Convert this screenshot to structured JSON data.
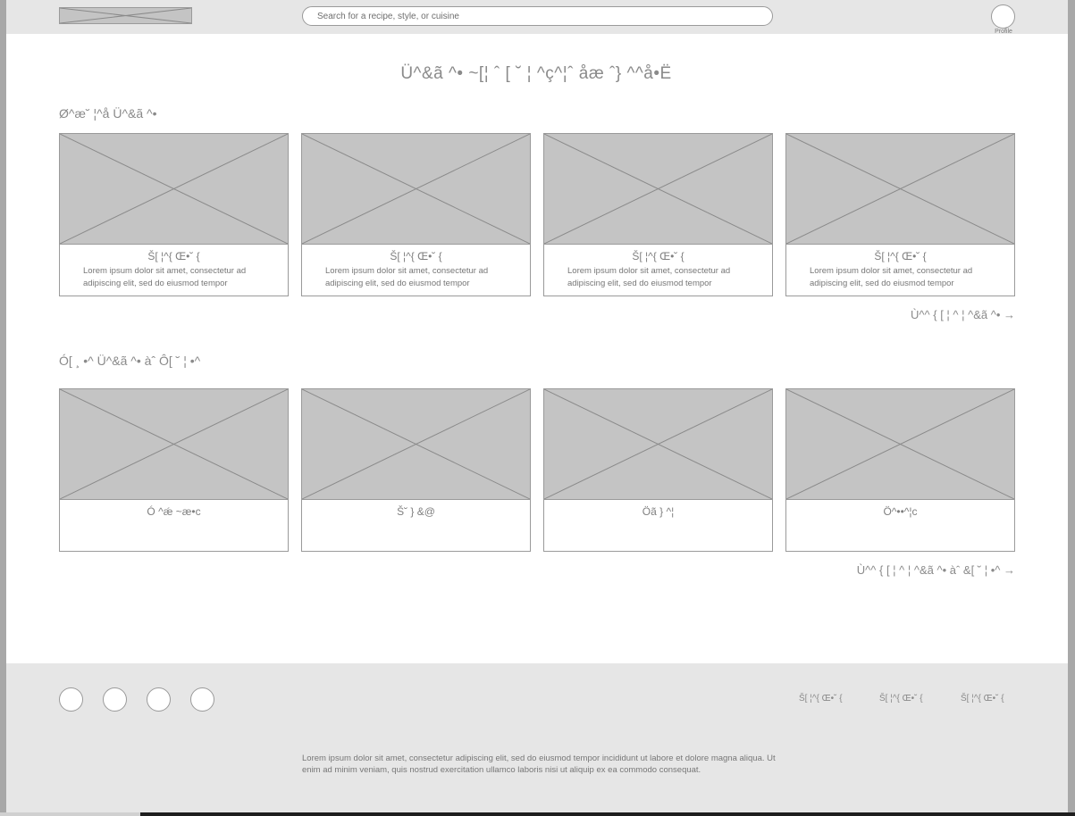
{
  "header": {
    "search_placeholder": "Search for a recipe, style, or cuisine",
    "profile_label": "Profile"
  },
  "page_title": "Ü^&ã ^• ~[¦ ˆ [ ˘ ¦ ^ç^¦ˆ åæ ˆ} ^^å•Ë",
  "popular": {
    "title": "Ø^æ˘ ¦^å Ü^&ã ^•",
    "cards": [
      {
        "title": "Š[ ¦^{   Œ•˘ {",
        "desc": "Lorem ipsum dolor sit amet, consectetur ad adipiscing elit, sed do eiusmod tempor"
      },
      {
        "title": "Š[ ¦^{   Œ•˘ {",
        "desc": "Lorem ipsum dolor sit amet, consectetur ad adipiscing elit, sed do eiusmod tempor"
      },
      {
        "title": "Š[ ¦^{   Œ•˘ {",
        "desc": "Lorem ipsum dolor sit amet, consectetur ad adipiscing elit, sed do eiusmod tempor"
      },
      {
        "title": "Š[ ¦^{   Œ•˘ {",
        "desc": "Lorem ipsum dolor sit amet, consectetur ad adipiscing elit, sed do eiusmod tempor"
      }
    ],
    "more": "Ù^^ { [ ¦ ^ ¦ ^&ã ^• →"
  },
  "browse": {
    "title": "Ó[ ¸ •^ Ü^&ã ^• àˆ  Ô[ ˘ ¦ •^",
    "cards": [
      {
        "title": "Ó ^ǽ ~æ•c"
      },
      {
        "title": "Š˘ } &@"
      },
      {
        "title": "Öã } ^¦"
      },
      {
        "title": "Ö^••^¦c"
      }
    ],
    "more": "Ù^^ { [ ¦ ^ ¦ ^&ã ^• àˆ  &[ ˘ ¦ •^ →"
  },
  "footer": {
    "links": [
      "Š[ ¦^{   Œ•˘ {",
      "Š[ ¦^{   Œ•˘ {",
      "Š[ ¦^{   Œ•˘ {"
    ],
    "text": "Lorem ipsum dolor sit amet, consectetur adipiscing elit, sed do eiusmod tempor incididunt ut labore et dolore magna aliqua. Ut enim ad minim veniam, quis nostrud exercitation ullamco laboris nisi ut aliquip ex ea commodo consequat."
  }
}
